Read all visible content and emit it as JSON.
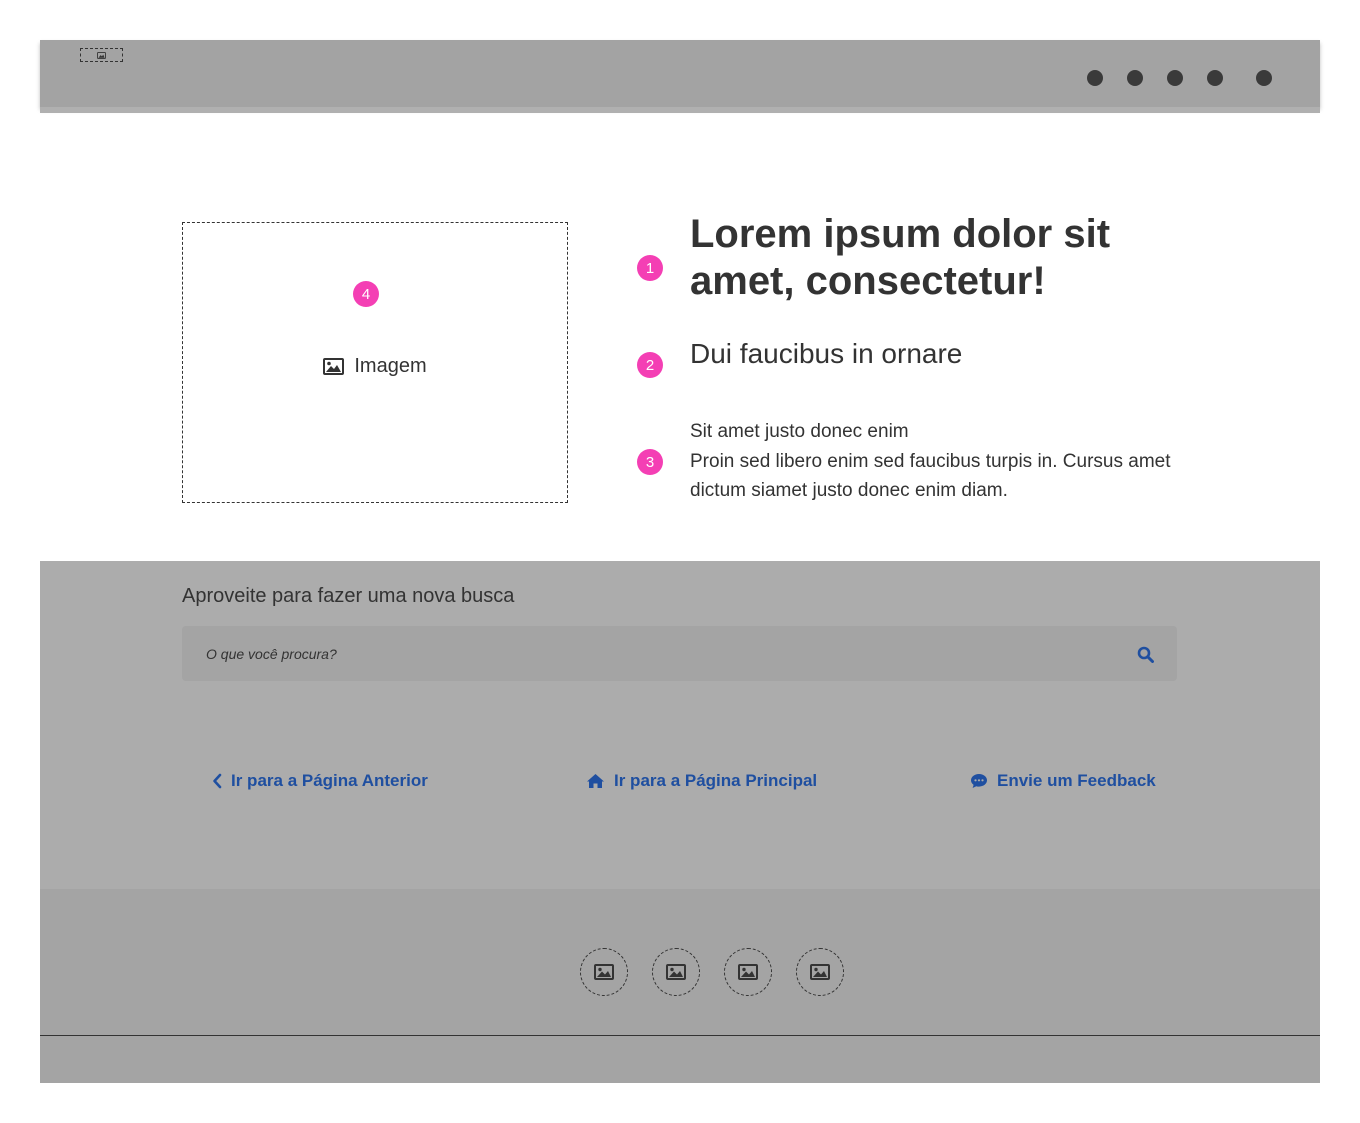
{
  "header": {
    "logo_icon": "image-icon",
    "nav_items": [
      "menu-dot",
      "menu-dot",
      "menu-dot",
      "menu-dot",
      "menu-dot"
    ]
  },
  "hero": {
    "image_label": "Imagem",
    "image_icon": "image-icon",
    "title": "Lorem ipsum dolor sit amet, consectetur!",
    "subtitle": "Dui faucibus in ornare",
    "body_line1": "Sit amet justo donec enim",
    "body_line2": "Proin sed libero enim sed faucibus turpis in. Cursus amet dictum siamet justo donec enim diam.",
    "markers": {
      "title": "1",
      "subtitle": "2",
      "body": "3",
      "image": "4"
    }
  },
  "search": {
    "title": "Aproveite para fazer uma nova busca",
    "placeholder": "O que você procura?",
    "icon": "search-icon"
  },
  "links": {
    "previous": "Ir para a Página Anterior",
    "home": "Ir para a Página Principal",
    "feedback": "Envie um Feedback"
  },
  "footer": {
    "social_icons": [
      "image-icon",
      "image-icon",
      "image-icon",
      "image-icon"
    ]
  },
  "colors": {
    "header_bg": "#a3a3a3",
    "search_section_bg": "#acacac",
    "footer_bg": "#a4a4a4",
    "marker": "#f43fb4",
    "link": "#1f4fa0",
    "text": "#333333"
  }
}
